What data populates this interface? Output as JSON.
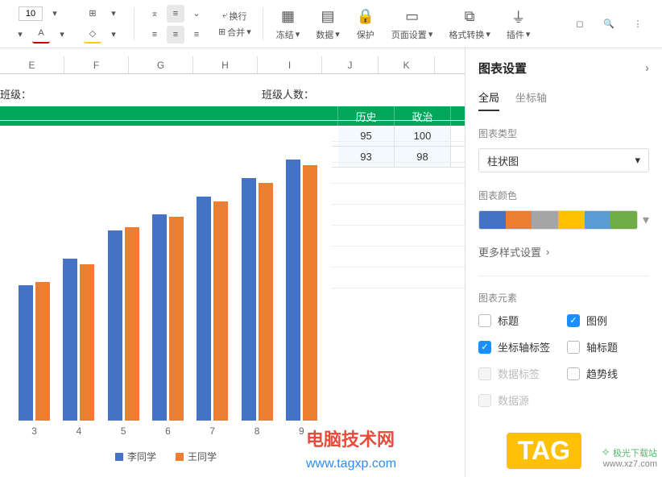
{
  "toolbar": {
    "fontSize": "10",
    "wrap": "换行",
    "merge": "合并",
    "freeze": "冻结",
    "data": "数据",
    "protect": "保护",
    "pageSetup": "页面设置",
    "formatConvert": "格式转换",
    "plugin": "插件"
  },
  "columns": [
    "E",
    "F",
    "G",
    "H",
    "I",
    "J",
    "K"
  ],
  "labels": {
    "class": "班级：",
    "classCount": "班级人数："
  },
  "table": {
    "headers": [
      "历史",
      "政治"
    ],
    "rows": [
      [
        "95",
        "100"
      ],
      [
        "93",
        "98"
      ]
    ]
  },
  "chart_data": {
    "type": "bar",
    "categories": [
      "3",
      "4",
      "5",
      "6",
      "7",
      "8",
      "9"
    ],
    "series": [
      {
        "name": "李同学",
        "values": [
          52,
          62,
          73,
          79,
          86,
          93,
          100
        ],
        "color": "#4472c4"
      },
      {
        "name": "王同学",
        "values": [
          53,
          60,
          74,
          78,
          84,
          91,
          98
        ],
        "color": "#ed7d31"
      }
    ],
    "ylim": [
      0,
      105
    ]
  },
  "panel": {
    "title": "图表设置",
    "tabs": {
      "global": "全局",
      "axis": "坐标轴"
    },
    "chartTypeLabel": "图表类型",
    "chartType": "柱状图",
    "chartColorLabel": "图表颜色",
    "palette": [
      "#4472c4",
      "#ed7d31",
      "#a5a5a5",
      "#ffc000",
      "#5b9bd5",
      "#70ad47"
    ],
    "moreStyles": "更多样式设置",
    "elementsLabel": "图表元素",
    "elements": {
      "title": "标题",
      "legend": "图例",
      "axisLabel": "坐标轴标签",
      "axisTitle": "轴标题",
      "dataLabel": "数据标签",
      "trendline": "趋势线",
      "dataSource": "数据源"
    },
    "checked": {
      "legend": true,
      "axisLabel": true
    }
  },
  "watermark": {
    "text": "电脑技术网",
    "url": "www.tagxp.com",
    "tag": "TAG",
    "dl1": "极光下载站",
    "dl2": "www.xz7.com"
  }
}
